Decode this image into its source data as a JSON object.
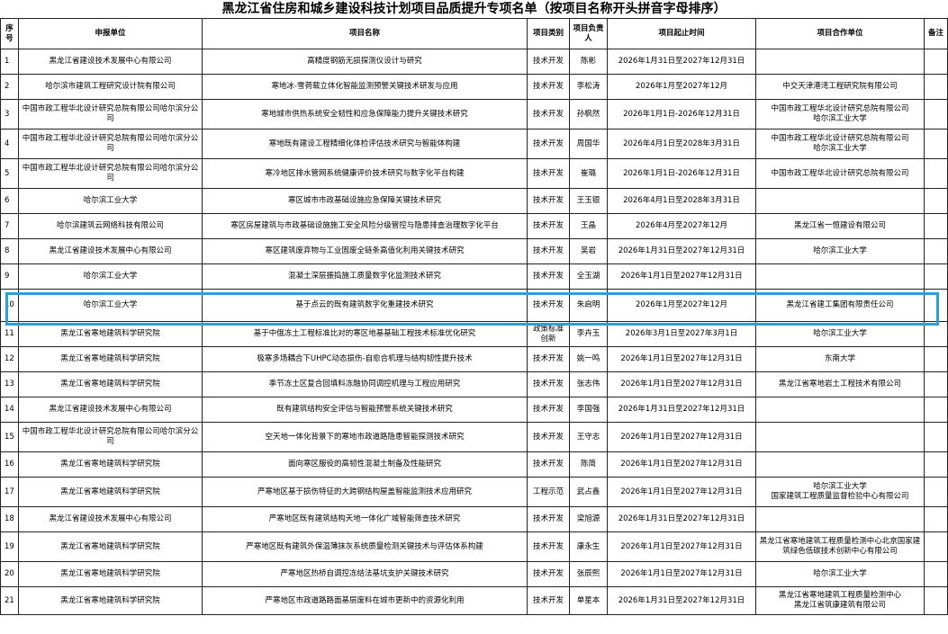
{
  "title": "黑龙江省住房和城乡建设科技计划项目品质提升专项名单（按项目名称开头拼音字母排序）",
  "headers": {
    "idx": "序号",
    "unit": "申报单位",
    "name": "项目名称",
    "type": "项目类别",
    "leader": "项目负责人",
    "period": "项目起止时间",
    "partner": "项目合作单位",
    "note": "备注"
  },
  "rows": [
    {
      "idx": "1",
      "unit": "黑龙江省建设技术发展中心有限公司",
      "name": "高精度钢筋无损探测仪设计与研究",
      "type": "技术开发",
      "leader": "陈彬",
      "period": "2026年1月31日至2027年12月31日",
      "partner": ""
    },
    {
      "idx": "2",
      "unit": "哈尔滨市建筑工程研究设计院有限公司",
      "name": "寒地冰-雪荷载立体化智能监测预警关键技术研发与应用",
      "type": "技术开发",
      "leader": "李松涛",
      "period": "2026年1月至2027年12月",
      "partner": "中交天津港湾工程研究院有限公司"
    },
    {
      "idx": "3",
      "unit": "中国市政工程华北设计研究总院有限公司哈尔滨分公司",
      "name": "寒地城市供热系统安全韧性和应急保障能力提升关键技术研究",
      "type": "技术开发",
      "leader": "孙枫然",
      "period": "2026年1月1日-2026年12月31日",
      "partner": "中国市政工程华北设计研究总院有限公司\n哈尔滨工业大学"
    },
    {
      "idx": "4",
      "unit": "中国市政工程华北设计研究总院有限公司哈尔滨分公司",
      "name": "寒地既有建设工程精细化体检评估技术研究与智能体构建",
      "type": "技术开发",
      "leader": "周国华",
      "period": "2026年4月1日至2028年3月31日",
      "partner": "中国市政工程华北设计研究总院有限公司\n哈尔滨工业大学"
    },
    {
      "idx": "5",
      "unit": "中国市政工程华北设计研究总院有限公司哈尔滨分公司",
      "name": "寒冷地区排水管网系统健康评价技术研究与数字化平台构建",
      "type": "技术开发",
      "leader": "崔璐",
      "period": "2026年1月1日-2026年12月31日",
      "partner": "中国市政工程华北设计研究总院有限公司"
    },
    {
      "idx": "6",
      "unit": "哈尔滨工业大学",
      "name": "寒区城市市政基础设施应急保障关键技术研究",
      "type": "技术开发",
      "leader": "王玉银",
      "period": "2026年4月1日至2028年3月31日",
      "partner": ""
    },
    {
      "idx": "7",
      "unit": "哈尔滨建筑云网络科技有限公司",
      "name": "寒区房屋建筑与市政基础设施施工安全风险分级管控与隐患排查治理数字化平台",
      "type": "技术开发",
      "leader": "王晶",
      "period": "2026年4月至2027年12月",
      "partner": "黑龙江省一恒建设有限公司"
    },
    {
      "idx": "8",
      "unit": "黑龙江省建设技术发展中心有限公司",
      "name": "寒区建筑废弃物与工业固废全链条高值化利用关键技术研究",
      "type": "技术开发",
      "leader": "吴岩",
      "period": "2026年1月31日至2027年12月31日",
      "partner": "哈尔滨工业大学"
    },
    {
      "idx": "9",
      "unit": "哈尔滨工业大学",
      "name": "混凝土深层振捣施工质量数字化监测技术研究",
      "type": "技术开发",
      "leader": "全玉湖",
      "period": "2026年1月1日至2027年12月31日",
      "partner": ""
    },
    {
      "idx": "10",
      "unit": "哈尔滨工业大学",
      "name": "基于点云的既有建筑数字化重建技术研究",
      "type": "技术开发",
      "leader": "朱启明",
      "period": "2026年1月至2027年12月",
      "partner": "黑龙江省建工集团有限责任公司"
    },
    {
      "idx": "11",
      "unit": "黑龙江省寒地建筑科学研究院",
      "name": "基于中俄冻土工程标准比对的寒区地基基础工程技术标准优化研究",
      "type": "政策标准创新",
      "leader": "李卉玉",
      "period": "2026年3月1日至2027年3月1日",
      "partner": "哈尔滨工业大学"
    },
    {
      "idx": "12",
      "unit": "黑龙江省寒地建筑科学研究院",
      "name": "极寒多场耦合下UHPC动态损伤-自愈合机理与结构韧性提升技术",
      "type": "技术开发",
      "leader": "姚一鸣",
      "period": "2026年1月1日至2027年12月31日",
      "partner": "东南大学"
    },
    {
      "idx": "13",
      "unit": "黑龙江省寒地建筑科学研究院",
      "name": "季节冻土区复合回填料冻融协同调控机理与工程应用研究",
      "type": "技术开发",
      "leader": "张志伟",
      "period": "2026年1月1日至2027年12月31日",
      "partner": "黑龙江省寒地岩土工程技术有限公司"
    },
    {
      "idx": "14",
      "unit": "黑龙江省建设技术发展中心有限公司",
      "name": "既有建筑结构安全评估与智能预警系统关键技术研究",
      "type": "技术开发",
      "leader": "李国强",
      "period": "2026年1月31日至2027年12月31日",
      "partner": ""
    },
    {
      "idx": "15",
      "unit": "中国市政工程华北设计研究总院有限公司哈尔滨分公司",
      "name": "空天地一体化背景下的寒地市政道路隐患智能探测技术研究",
      "type": "技术开发",
      "leader": "王守志",
      "period": "2026年1月1日至2027年12月31日",
      "partner": ""
    },
    {
      "idx": "16",
      "unit": "黑龙江省寒地建筑科学研究院",
      "name": "面向寒区服役的高韧性混凝土制备及性能研究",
      "type": "技术开发",
      "leader": "陈简",
      "period": "2026年1月1日至2027年12月31日",
      "partner": ""
    },
    {
      "idx": "17",
      "unit": "黑龙江省寒地建筑科学研究院",
      "name": "严寒地区基于损伤特征的大跨钢结构屋盖智能监测技术应用研究",
      "type": "工程示范",
      "leader": "武占鑫",
      "period": "2026年1月1日至2027年12月31日",
      "partner": "哈尔滨工业大学\n国家建筑工程质量监督检验中心有限公司"
    },
    {
      "idx": "18",
      "unit": "黑龙江省建设技术发展中心有限公司",
      "name": "严寒地区既有建筑结构天地一体化广域智能筛查技术研究",
      "type": "技术开发",
      "leader": "梁旭源",
      "period": "2026年1月31日至2027年12月31日",
      "partner": ""
    },
    {
      "idx": "19",
      "unit": "黑龙江省寒地建筑科学研究院",
      "name": "严寒地区既有建筑外保温薄抹灰系统质量检测关键技术与评估体系构建",
      "type": "技术开发",
      "leader": "康永生",
      "period": "2026年1月1日至2027年12月31日",
      "partner": "黑龙江省寒地建筑工程质量检测中心北京国家建筑绿色低碳技术创新中心有限公司"
    },
    {
      "idx": "20",
      "unit": "黑龙江省寒地建筑科学研究院",
      "name": "严寒地区热桥自调控冻结法基坑支护关键技术研究",
      "type": "技术开发",
      "leader": "张辰熙",
      "period": "2026年1月1日至2027年12月31日",
      "partner": "哈尔滨工业大学"
    },
    {
      "idx": "21",
      "unit": "黑龙江省寒地建筑科学研究院",
      "name": "严寒地区市政道路路面基层废料在城市更新中的资源化利用",
      "type": "技术开发",
      "leader": "单星本",
      "period": "2026年1月31日至2027年12月31日",
      "partner": "黑龙江省寒地建筑工程质量检测中心\n黑龙江省筑康建筑有限公司"
    }
  ]
}
